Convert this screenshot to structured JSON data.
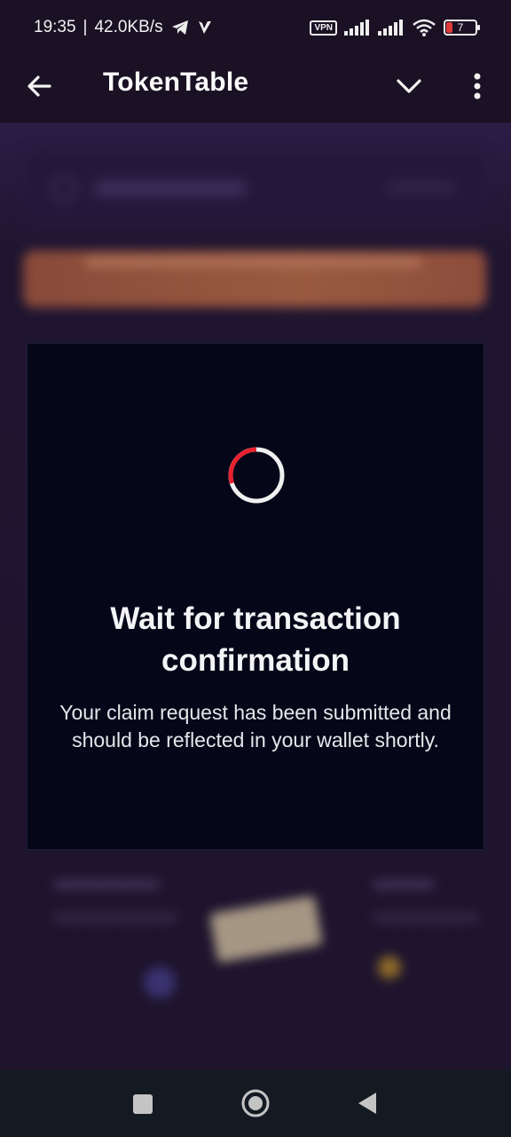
{
  "status_bar": {
    "time": "19:35",
    "separator": "|",
    "speed": "42.0KB/s",
    "vpn": "VPN",
    "battery": "7",
    "icons": [
      "telegram-icon",
      "vpn-app-icon",
      "signal-icon",
      "wifi-icon",
      "battery-icon"
    ]
  },
  "app_bar": {
    "title": "TokenTable",
    "back_icon": "arrow-left-icon",
    "dropdown_icon": "chevron-down-icon",
    "menu_icon": "more-vertical-icon"
  },
  "modal": {
    "title": "Wait for transaction confirmation",
    "description": "Your claim request has been submitted and should be reflected in your wallet shortly.",
    "spinner_icon": "loading-spinner-icon",
    "spinner_color": "#e8212f",
    "spinner_track_color": "#f0f0f0"
  },
  "nav_bar": {
    "icons": [
      "recent-apps-icon",
      "home-icon",
      "back-icon"
    ]
  },
  "colors": {
    "status_bar_bg": "#1a1124",
    "modal_bg": "#050719",
    "nav_bar_bg": "#141a22"
  }
}
